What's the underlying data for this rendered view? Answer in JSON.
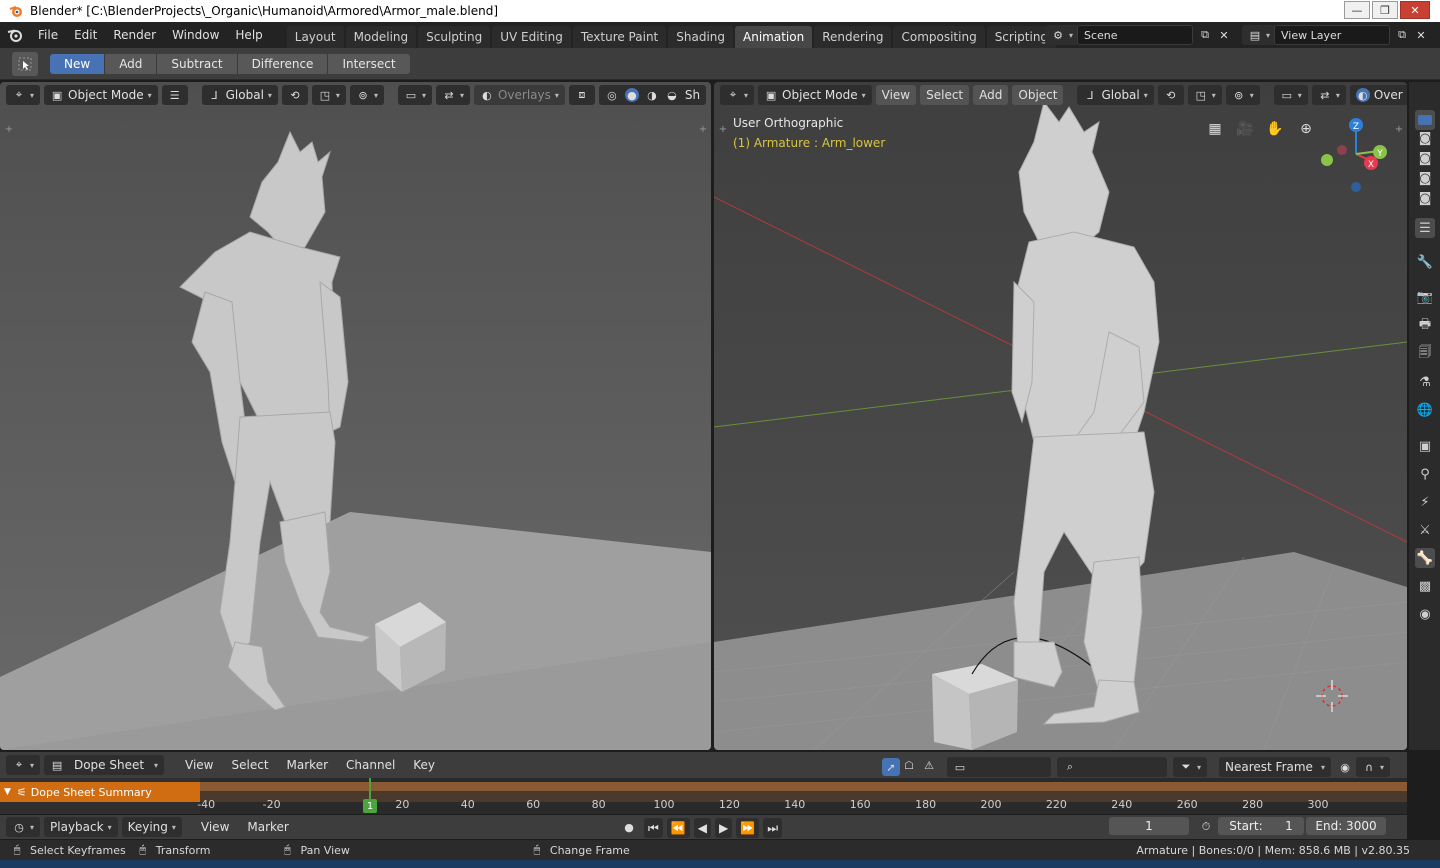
{
  "window": {
    "title": "Blender* [C:\\BlenderProjects\\_Organic\\Humanoid\\Armored\\Armor_male.blend]",
    "minimize": "—",
    "maximize": "❐",
    "close": "✕"
  },
  "menubar": {
    "items": [
      "File",
      "Edit",
      "Render",
      "Window",
      "Help"
    ]
  },
  "workspaces": {
    "tabs": [
      "Layout",
      "Modeling",
      "Sculpting",
      "UV Editing",
      "Texture Paint",
      "Shading",
      "Animation",
      "Rendering",
      "Compositing",
      "Scripting"
    ],
    "active": "Animation",
    "add": "+"
  },
  "scene": {
    "name": "Scene",
    "view_layer": "View Layer"
  },
  "tool_header": {
    "modes": [
      "New",
      "Add",
      "Subtract",
      "Difference",
      "Intersect"
    ],
    "active": "New"
  },
  "left_viewport": {
    "mode": "Object Mode",
    "orientation": "Global",
    "overlays": "Overlays",
    "shading_cut": "Sh"
  },
  "right_viewport": {
    "mode": "Object Mode",
    "menus": [
      "View",
      "Select",
      "Add",
      "Object"
    ],
    "orientation": "Global",
    "overlays_cut": "Over",
    "view_name": "User Orthographic",
    "active_object": "(1) Armature : Arm_lower",
    "gizmo_axes": {
      "x": "X",
      "y": "Y",
      "z": "Z"
    }
  },
  "dope_sheet": {
    "editor": "Dope Sheet",
    "menus": [
      "View",
      "Select",
      "Marker",
      "Channel",
      "Key"
    ],
    "summary": "Dope Sheet Summary",
    "snap": "Nearest Frame",
    "ticks": [
      "-40",
      "-20",
      "20",
      "40",
      "60",
      "80",
      "100",
      "120",
      "140",
      "160",
      "180",
      "200",
      "220",
      "240",
      "260",
      "280",
      "300"
    ],
    "current_frame_label": "1"
  },
  "timeline": {
    "playback": "Playback",
    "keying": "Keying",
    "menus": [
      "View",
      "Marker"
    ],
    "current_frame": "1",
    "start": "Start:",
    "start_value": "1",
    "end": "End: 3000"
  },
  "statusbar": {
    "select": "Select Keyframes",
    "transform": "Transform",
    "pan": "Pan View",
    "change_frame": "Change Frame",
    "info": "Armature | Bones:0/0  |  Mem: 858.6 MB | v2.80.35"
  },
  "colors": {
    "accent": "#4772b3",
    "summary": "#d06d12",
    "current_frame": "#49a53c",
    "x_axis": "#e8394e",
    "y_axis": "#8bc34a",
    "z_axis": "#2f7fd8"
  }
}
